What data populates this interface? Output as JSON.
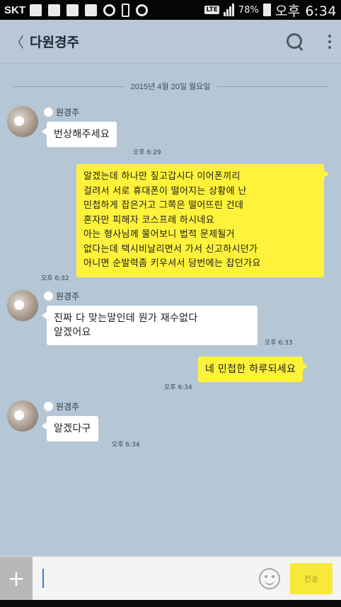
{
  "status_bar": {
    "carrier": "SKT",
    "lte": "LTE",
    "battery": "78%",
    "time": "오후 6:34"
  },
  "header": {
    "back_glyph": "〈",
    "title": "다원경주",
    "search_icon": "search-icon",
    "more_icon": "more-vertical-icon"
  },
  "chat": {
    "date": "2015년 4월 20일 월요일",
    "messages": [
      {
        "from": "other",
        "sender": "원경주",
        "text": "번상해주세요",
        "time": "오후 6:29"
      },
      {
        "from": "me",
        "text": "알겠는데 하나만 짚고갑시다 이어폰끼리\n걸려서 서로 휴대폰이 떨어지는 상황에 난\n민첩하게 잡은거고 그쪽은 떨어뜨린 건데\n혼자만 피해자 코스프레 하시네요\n아는 형사님께 물어보니 법적 문제될거\n없다는데 택시비날리면서 가서 신고하시던가\n아니면 순발력좀 키우셔서 담번에는 잡던가요",
        "time": "오후 6:32"
      },
      {
        "from": "other",
        "sender": "원경주",
        "text": "진짜 다 맞는말인데 뭔가 재수없다\n알겠어요",
        "time": "오후 6:33"
      },
      {
        "from": "me",
        "text": "네 민첩한 하루되세요",
        "time": "오후 6:34"
      },
      {
        "from": "other",
        "sender": "원경주",
        "text": "알겠다구",
        "time": "오후 6:34"
      }
    ]
  },
  "input": {
    "placeholder": "",
    "plus_label": "+",
    "send_label": "전송",
    "emoji_icon": "emoji-icon"
  },
  "colors": {
    "chat_bg": "#b5c6d5",
    "header_bg": "#b9c8d6",
    "my_bubble": "#fff23a",
    "their_bubble": "#ffffff",
    "send_button": "#f7e93a"
  }
}
